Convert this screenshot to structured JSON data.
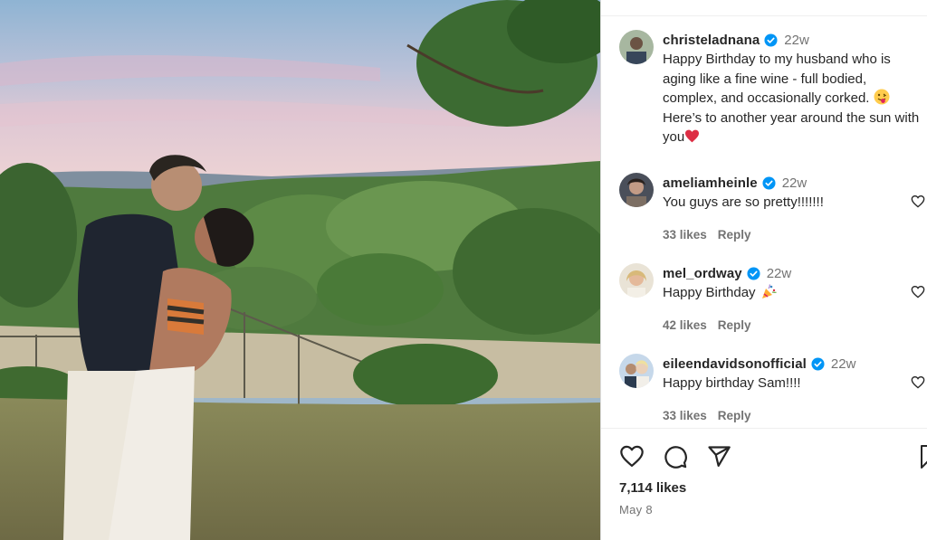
{
  "post": {
    "author": "christeladnana",
    "time": "22w",
    "caption": "Happy Birthday to my husband who is aging like a fine wine - full bodied, complex, and occasionally corked.",
    "caption_tail": "Here’s to another year around the sun with you",
    "caption_emoji_1": "face-with-tongue-emoji",
    "caption_emoji_2": "red-heart-emoji"
  },
  "comments": [
    {
      "username": "ameliamheinle",
      "time": "22w",
      "text": "You guys are so pretty!!!!!!!",
      "likes": "33 likes",
      "reply": "Reply"
    },
    {
      "username": "mel_ordway",
      "time": "22w",
      "text": "Happy Birthday",
      "emoji": "party-popper-emoji",
      "likes": "42 likes",
      "reply": "Reply"
    },
    {
      "username": "eileendavidsonofficial",
      "time": "22w",
      "text": "Happy birthday Sam!!!!",
      "likes": "33 likes",
      "reply": "Reply"
    }
  ],
  "actions": {
    "icons": [
      "heart-icon",
      "comment-icon",
      "share-icon",
      "bookmark-icon"
    ]
  },
  "stats": {
    "likes": "7,114 likes",
    "date": "May 8"
  },
  "colors": {
    "verified": "#0095f6",
    "heart": "#ed4956",
    "secondary_text": "#737373"
  }
}
